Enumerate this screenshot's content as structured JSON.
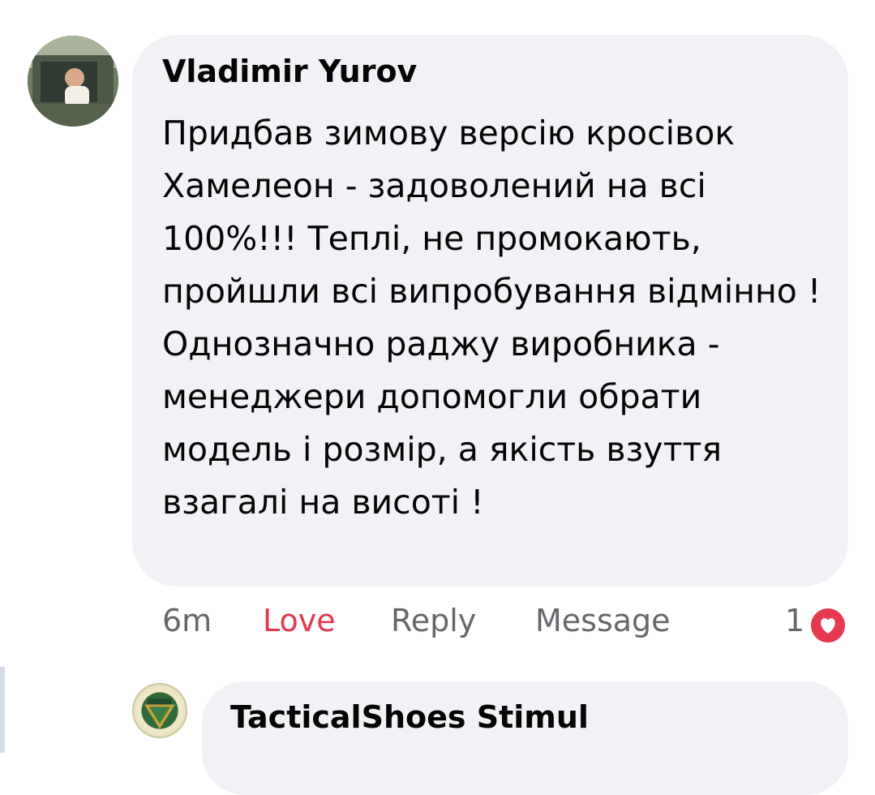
{
  "comment": {
    "author": "Vladimir  Yurov",
    "text": "Придбав зимову версію кросівок Хамелеон - задоволений на всі 100%!!! Теплі, не промокають, пройшли всі випробування відмінно ! Однозначно раджу виробника - менеджери допомогли обрати модель і розмір, а якість взуття взагалі на висоті !",
    "avatar_icon": "user-photo-avatar",
    "actions": {
      "time": "6m",
      "love": "Love",
      "reply": "Reply",
      "message": "Message"
    },
    "reaction": {
      "count": "1",
      "icon": "heart-love-icon",
      "color": "#e4394f"
    }
  },
  "reply": {
    "author": "TacticalShoes Stimul",
    "avatar_icon": "brand-logo-avatar"
  }
}
